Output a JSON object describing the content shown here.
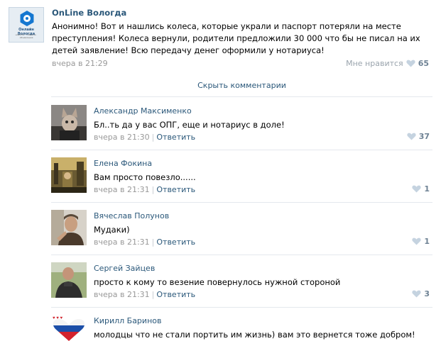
{
  "post": {
    "group_name": "OnLine Вологда",
    "logo_title": "Онлайн Вологда",
    "logo_subtitle": "новости · события · объявления",
    "text": "Анонимно! Вот и нашлись колеса, которые украли и паспорт потеряли на месте преступления! Колеса вернули, родители предложили 30 000 что бы не писал на их детей заявление! Всю передачу денег оформили у нотариуса!",
    "time": "вчера в 21:29",
    "like_label": "Мне нравится",
    "like_count": "65",
    "icons": {
      "like": "heart-icon"
    }
  },
  "comments_toggle": "Скрыть комментарии",
  "comments": [
    {
      "name": "Александр Максименко",
      "text": "Бл..ть да у вас ОПГ, еще и нотариус в доле!",
      "time": "вчера в 21:30",
      "separator": "|",
      "reply": "Ответить",
      "likes": "37",
      "avatar_icon": "cat-avatar-icon"
    },
    {
      "name": "Елена Фокина",
      "text": "Вам просто повезло......",
      "time": "вчера в 21:31",
      "separator": "|",
      "reply": "Ответить",
      "likes": "1",
      "avatar_icon": "city-photo-avatar-icon"
    },
    {
      "name": "Вячеслав Полунов",
      "text": "Мудаки)",
      "time": "вчера в 21:31",
      "separator": "|",
      "reply": "Ответить",
      "likes": "1",
      "avatar_icon": "man-photo-avatar-icon"
    },
    {
      "name": "Сергей Зайцев",
      "text": "просто к кому то везение повернулось нужной стороной",
      "time": "вчера в 21:31",
      "separator": "|",
      "reply": "Ответить",
      "likes": "3",
      "avatar_icon": "man-outdoors-avatar-icon"
    },
    {
      "name": "Кирилл Баринов",
      "text": "молодцы что не стали портить им жизнь) вам это вернется тоже добром!",
      "avatar_icon": "flag-heart-avatar-icon"
    }
  ],
  "colors": {
    "link": "#2b587a",
    "meta": "#999999",
    "like_count": "#6e8294",
    "divider": "#e4e8ed"
  }
}
